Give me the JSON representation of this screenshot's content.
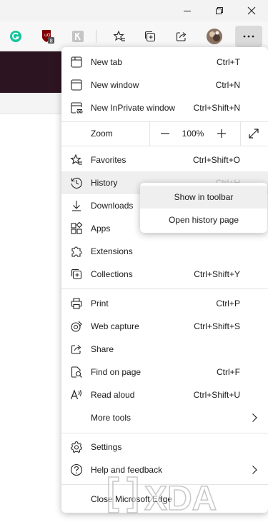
{
  "toolbar": {
    "extensions": [
      {
        "name": "grammarly-icon",
        "color": "#15c39a",
        "glyph": "G"
      },
      {
        "name": "ublock-icon",
        "color": "#800000",
        "badge": "8"
      },
      {
        "name": "extension-icon",
        "color": "#c4c4c4"
      }
    ]
  },
  "menu": {
    "new_tab": {
      "label": "New tab",
      "shortcut": "Ctrl+T"
    },
    "new_window": {
      "label": "New window",
      "shortcut": "Ctrl+N"
    },
    "new_inprivate": {
      "label": "New InPrivate window",
      "shortcut": "Ctrl+Shift+N"
    },
    "zoom": {
      "label": "Zoom",
      "value": "100%"
    },
    "favorites": {
      "label": "Favorites",
      "shortcut": "Ctrl+Shift+O"
    },
    "history": {
      "label": "History",
      "shortcut": "Ctrl+H"
    },
    "downloads": {
      "label": "Downloads"
    },
    "apps": {
      "label": "Apps"
    },
    "extensions": {
      "label": "Extensions"
    },
    "collections": {
      "label": "Collections",
      "shortcut": "Ctrl+Shift+Y"
    },
    "print": {
      "label": "Print",
      "shortcut": "Ctrl+P"
    },
    "web_capture": {
      "label": "Web capture",
      "shortcut": "Ctrl+Shift+S"
    },
    "share": {
      "label": "Share"
    },
    "find_on_page": {
      "label": "Find on page",
      "shortcut": "Ctrl+F"
    },
    "read_aloud": {
      "label": "Read aloud",
      "shortcut": "Ctrl+Shift+U"
    },
    "more_tools": {
      "label": "More tools"
    },
    "settings": {
      "label": "Settings"
    },
    "help_feedback": {
      "label": "Help and feedback"
    },
    "close_edge": {
      "label": "Close Microsoft Edge"
    }
  },
  "history_submenu": {
    "show_in_toolbar": "Show in toolbar",
    "open_history_page": "Open history page"
  },
  "watermark": {
    "text": "XDA"
  },
  "colors": {
    "page_banner": "#2c1420",
    "menu_hover": "#efefef",
    "separator": "#e4e4e4"
  }
}
